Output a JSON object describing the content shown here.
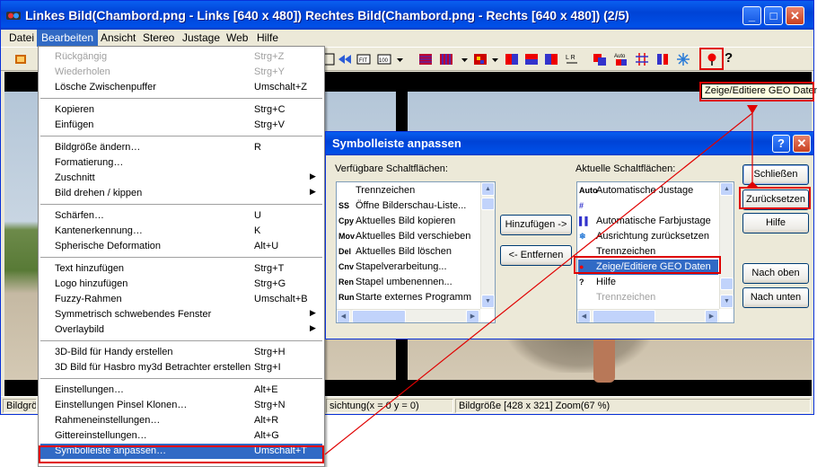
{
  "window": {
    "title": "Linkes Bild(Chambord.png - Links [640 x 480]) Rechtes Bild(Chambord.png - Rechts [640 x 480])  (2/5)",
    "controls": [
      "_",
      "□",
      "✕"
    ]
  },
  "menubar": [
    "Datei",
    "Bearbeiten",
    "Ansicht",
    "Stereo",
    "Justage",
    "Web",
    "Hilfe"
  ],
  "edit_menu": [
    {
      "label": "Rückgängig",
      "shortcut": "Strg+Z",
      "disabled": true
    },
    {
      "label": "Wiederholen",
      "shortcut": "Strg+Y",
      "disabled": true
    },
    {
      "label": "Lösche Zwischenpuffer",
      "shortcut": "Umschalt+Z"
    },
    {
      "sep": true
    },
    {
      "label": "Kopieren",
      "shortcut": "Strg+C"
    },
    {
      "label": "Einfügen",
      "shortcut": "Strg+V"
    },
    {
      "sep": true
    },
    {
      "label": "Bildgröße ändern…",
      "shortcut": "R"
    },
    {
      "label": "Formatierung…",
      "shortcut": ""
    },
    {
      "label": "Zuschnitt",
      "shortcut": "",
      "submenu": true
    },
    {
      "label": "Bild drehen / kippen",
      "shortcut": "",
      "submenu": true
    },
    {
      "sep": true
    },
    {
      "label": "Schärfen…",
      "shortcut": "U"
    },
    {
      "label": "Kantenerkennung…",
      "shortcut": "K"
    },
    {
      "label": "Spherische Deformation",
      "shortcut": "Alt+U"
    },
    {
      "sep": true
    },
    {
      "label": "Text hinzufügen",
      "shortcut": "Strg+T"
    },
    {
      "label": "Logo hinzufügen",
      "shortcut": "Strg+G"
    },
    {
      "label": "Fuzzy-Rahmen",
      "shortcut": "Umschalt+B"
    },
    {
      "label": "Symmetrisch schwebendes Fenster",
      "shortcut": "",
      "submenu": true
    },
    {
      "label": "Overlaybild",
      "shortcut": "",
      "submenu": true
    },
    {
      "sep": true
    },
    {
      "label": "3D-Bild für Handy erstellen",
      "shortcut": "Strg+H"
    },
    {
      "label": "3D Bild für Hasbro my3d Betrachter erstellen",
      "shortcut": "Strg+I"
    },
    {
      "sep": true
    },
    {
      "label": "Einstellungen…",
      "shortcut": "Alt+E"
    },
    {
      "label": "Einstellungen Pinsel Klonen…",
      "shortcut": "Strg+N"
    },
    {
      "label": "Rahmeneinstellungen…",
      "shortcut": "Alt+R"
    },
    {
      "label": "Gittereinstellungen…",
      "shortcut": "Alt+G"
    },
    {
      "label": "Symbolleiste anpassen…",
      "shortcut": "Umschalt+T",
      "selected": true
    }
  ],
  "toolbar_tooltip": "Zeige/Editiere GEO Daten",
  "status": {
    "left": "Bildgröß",
    "middle": "sichtung(x = 0 y = 0)",
    "right": "Bildgröße [428 x 321]  Zoom(67 %)"
  },
  "dialog": {
    "title": "Symbolleiste anpassen",
    "available_label": "Verfügbare Schaltflächen:",
    "current_label": "Aktuelle Schaltflächen:",
    "available": [
      {
        "icon": "",
        "text": "Trennzeichen"
      },
      {
        "icon": "SS",
        "text": "Öffne Bilderschau-Liste..."
      },
      {
        "icon": "Cpy",
        "text": "Aktuelles Bild kopieren"
      },
      {
        "icon": "Mov",
        "text": "Aktuelles Bild verschieben"
      },
      {
        "icon": "Del",
        "text": "Aktuelles Bild löschen"
      },
      {
        "icon": "Cnv",
        "text": "Stapelverarbeitung..."
      },
      {
        "icon": "Ren",
        "text": "Stapel umbenennen..."
      },
      {
        "icon": "Run",
        "text": "Starte externes Programm"
      }
    ],
    "current": [
      {
        "icon": "Auto",
        "text": "Automatische Justage"
      },
      {
        "icon": "#",
        "text": ""
      },
      {
        "icon": "▌▌",
        "text": "Automatische Farbjustage"
      },
      {
        "icon": "❄",
        "text": "Ausrichtung zurücksetzen"
      },
      {
        "icon": "",
        "text": "Trennzeichen"
      },
      {
        "icon": "●",
        "text": "Zeige/Editiere GEO Daten",
        "selected": true
      },
      {
        "icon": "?",
        "text": "Hilfe"
      },
      {
        "icon": "",
        "text": "Trennzeichen",
        "grey": true
      }
    ],
    "buttons": {
      "add": "Hinzufügen ->",
      "remove": "<- Entfernen",
      "close": "Schließen",
      "reset": "Zurücksetzen",
      "help": "Hilfe",
      "up": "Nach oben",
      "down": "Nach unten"
    }
  }
}
